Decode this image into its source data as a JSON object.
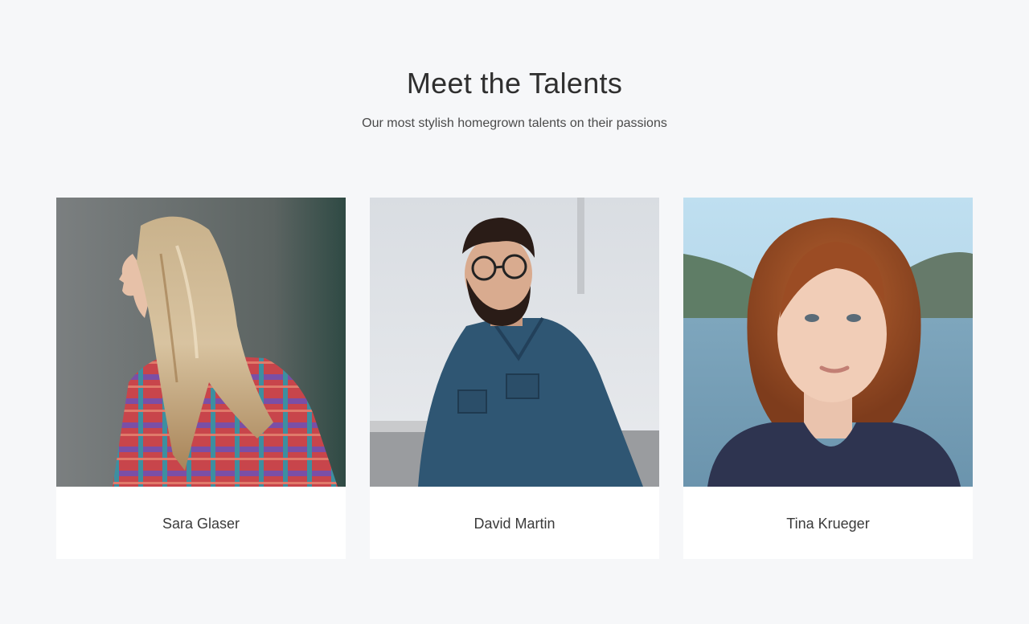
{
  "section": {
    "title": "Meet the Talents",
    "subtitle": "Our most stylish homegrown talents on their passions"
  },
  "talents": [
    {
      "name": "Sara Glaser",
      "photo_icon": "portrait-photo"
    },
    {
      "name": "David Martin",
      "photo_icon": "portrait-photo"
    },
    {
      "name": "Tina Krueger",
      "photo_icon": "portrait-photo"
    }
  ],
  "colors": {
    "page_background": "#f6f7f9",
    "card_background": "#ffffff",
    "text": "#333333"
  }
}
